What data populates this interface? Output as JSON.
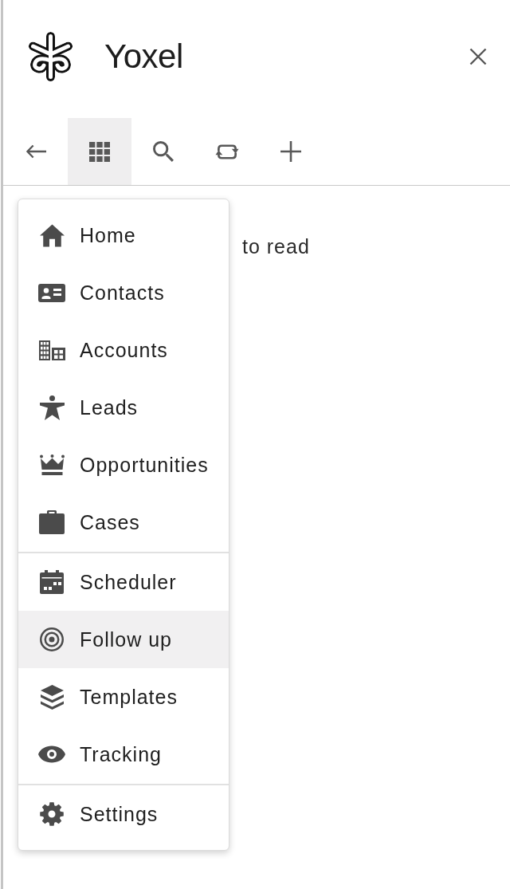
{
  "header": {
    "title": "Yoxel"
  },
  "toolbar": [
    {
      "selected": false
    },
    {
      "selected": true
    },
    {
      "selected": false
    },
    {
      "selected": false
    },
    {
      "selected": false
    }
  ],
  "content": {
    "text": "to read"
  },
  "menu": {
    "groups": [
      {
        "items": [
          {
            "label": "Home",
            "selected": false
          },
          {
            "label": "Contacts",
            "selected": false
          },
          {
            "label": "Accounts",
            "selected": false
          },
          {
            "label": "Leads",
            "selected": false
          },
          {
            "label": "Opportunities",
            "selected": false
          },
          {
            "label": "Cases",
            "selected": false
          }
        ]
      },
      {
        "items": [
          {
            "label": "Scheduler",
            "selected": false
          },
          {
            "label": "Follow up",
            "selected": true
          },
          {
            "label": "Templates",
            "selected": false
          },
          {
            "label": "Tracking",
            "selected": false
          }
        ]
      },
      {
        "items": [
          {
            "label": "Settings",
            "selected": false
          }
        ]
      }
    ]
  }
}
